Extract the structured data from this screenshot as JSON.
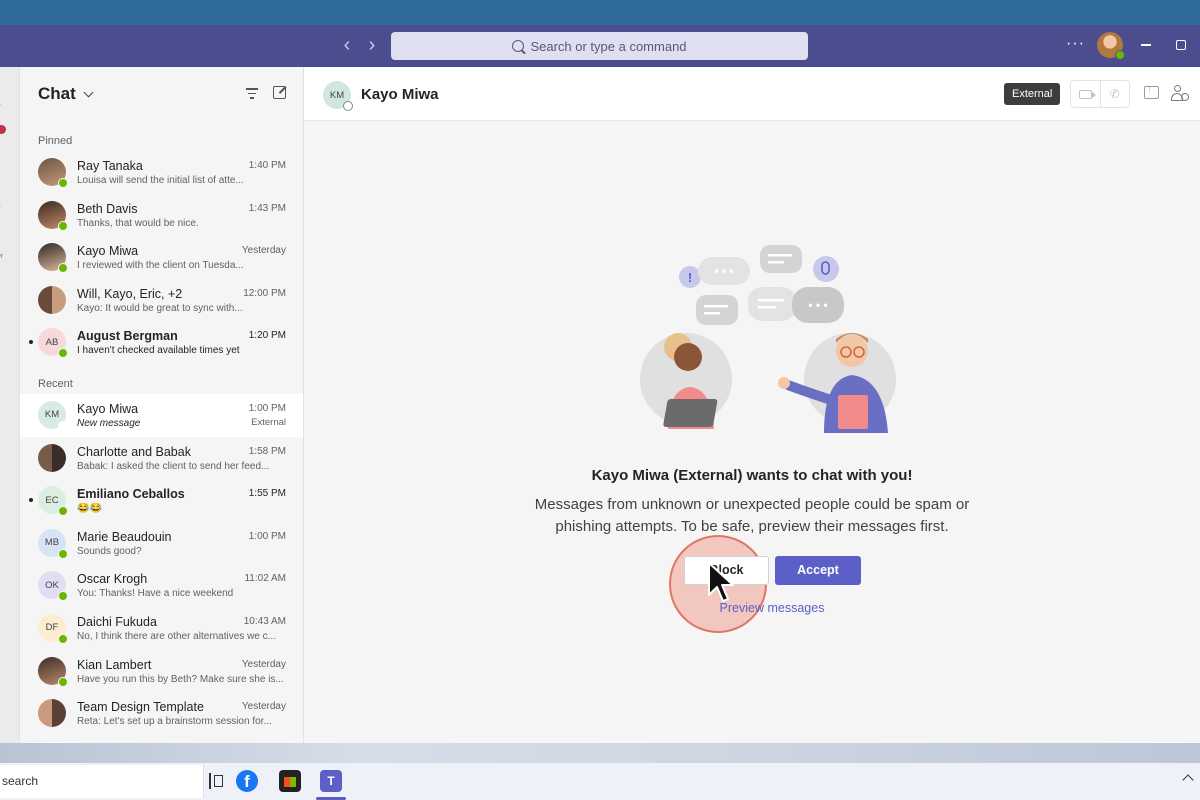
{
  "titlebar": {
    "search_placeholder": "Search or type a command",
    "more_label": "···"
  },
  "chat_list": {
    "title": "Chat",
    "pinned_label": "Pinned",
    "recent_label": "Recent",
    "pinned": [
      {
        "name": "Ray Tanaka",
        "time": "1:40 PM",
        "preview": "Louisa will send the initial list of atte...",
        "initials": "",
        "bold": false
      },
      {
        "name": "Beth Davis",
        "time": "1:43 PM",
        "preview": "Thanks, that would be nice.",
        "initials": "",
        "bold": false
      },
      {
        "name": "Kayo Miwa",
        "time": "Yesterday",
        "preview": "I reviewed with the client on Tuesda...",
        "initials": "",
        "bold": false
      },
      {
        "name": "Will, Kayo, Eric, +2",
        "time": "12:00 PM",
        "preview": "Kayo: It would be great to sync with...",
        "initials": "",
        "bold": false
      },
      {
        "name": "August Bergman",
        "time": "1:20 PM",
        "preview": "I haven't checked available times yet",
        "initials": "AB",
        "bold": true
      }
    ],
    "recent": [
      {
        "name": "Kayo Miwa",
        "time": "1:00 PM",
        "preview": "New message",
        "extra": "External",
        "initials": "KM",
        "bold": false
      },
      {
        "name": "Charlotte and Babak",
        "time": "1:58 PM",
        "preview": "Babak: I asked the client to send her feed...",
        "initials": "",
        "bold": false
      },
      {
        "name": "Emiliano Ceballos",
        "time": "1:55 PM",
        "preview": "😂😂",
        "initials": "EC",
        "bold": true
      },
      {
        "name": "Marie Beaudouin",
        "time": "1:00 PM",
        "preview": "Sounds good?",
        "initials": "MB",
        "bold": false
      },
      {
        "name": "Oscar Krogh",
        "time": "11:02 AM",
        "preview": "You: Thanks! Have a nice weekend",
        "initials": "OK",
        "bold": false
      },
      {
        "name": "Daichi Fukuda",
        "time": "10:43 AM",
        "preview": "No, I think there are other alternatives we c...",
        "initials": "DF",
        "bold": false
      },
      {
        "name": "Kian Lambert",
        "time": "Yesterday",
        "preview": "Have you run this by Beth? Make sure she is...",
        "initials": "",
        "bold": false
      },
      {
        "name": "Team Design Template",
        "time": "Yesterday",
        "preview": "Reta: Let's set up a brainstorm session for...",
        "initials": "",
        "bold": false
      }
    ]
  },
  "conversation": {
    "initials": "KM",
    "name": "Kayo Miwa",
    "external_badge": "External",
    "request_title": "Kayo Miwa (External) wants to chat with you!",
    "request_body_line1": "Messages from unknown or unexpected people could be spam or",
    "request_body_line2": "phishing attempts. To be safe, preview their messages first.",
    "block_label": "Block",
    "accept_label": "Accept",
    "preview_label": "Preview messages"
  },
  "taskbar": {
    "search_text": "search",
    "facebook_glyph": "f",
    "teams_glyph": "T"
  },
  "colors": {
    "titlebar": "#4b4d8f",
    "accent": "#5b5fc7",
    "presence_available": "#6bb700",
    "click_highlight": "#ed735f"
  }
}
